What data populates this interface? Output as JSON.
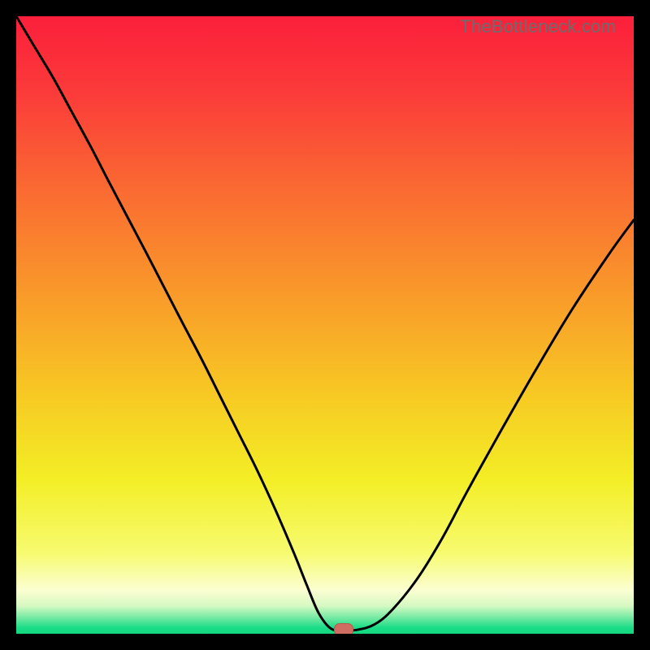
{
  "watermark": "TheBottleneck.com",
  "colors": {
    "frame": "#000000",
    "watermark": "#6c6c6c",
    "curve": "#000000",
    "marker_fill": "#cf6d63",
    "marker_stroke": "#bb564c",
    "gradient_stops": [
      {
        "offset": 0.0,
        "color": "#fb1f3b"
      },
      {
        "offset": 0.12,
        "color": "#fb3a3a"
      },
      {
        "offset": 0.28,
        "color": "#fa6a32"
      },
      {
        "offset": 0.45,
        "color": "#f99a2a"
      },
      {
        "offset": 0.62,
        "color": "#f7cb23"
      },
      {
        "offset": 0.75,
        "color": "#f3ee26"
      },
      {
        "offset": 0.87,
        "color": "#f7fb70"
      },
      {
        "offset": 0.93,
        "color": "#fbfed2"
      },
      {
        "offset": 0.955,
        "color": "#d5f9c2"
      },
      {
        "offset": 0.975,
        "color": "#6fe9a1"
      },
      {
        "offset": 0.99,
        "color": "#1bdd87"
      },
      {
        "offset": 1.0,
        "color": "#13d77f"
      }
    ]
  },
  "chart_data": {
    "type": "line",
    "title": "",
    "xlabel": "",
    "ylabel": "",
    "xlim": [
      0,
      100
    ],
    "ylim": [
      0,
      100
    ],
    "grid": false,
    "legend": false,
    "series": [
      {
        "name": "curve",
        "x": [
          0,
          3,
          6,
          9,
          12,
          15,
          18,
          21,
          24,
          27,
          30,
          33,
          36,
          39,
          42,
          45,
          47,
          49,
          51,
          53,
          55,
          58,
          61,
          65,
          69,
          73,
          78,
          84,
          90,
          96,
          100
        ],
        "y": [
          100,
          95,
          90,
          84.5,
          79,
          73.2,
          67.5,
          61.8,
          56,
          50.2,
          44.5,
          38.5,
          32.5,
          26.5,
          20,
          13,
          8,
          3.3,
          0.8,
          0.6,
          0.6,
          1.5,
          4,
          9,
          15.5,
          23,
          32,
          42.5,
          52.5,
          61.5,
          67
        ]
      }
    ],
    "minimum_marker": {
      "x": 53,
      "y": 0.6
    }
  }
}
